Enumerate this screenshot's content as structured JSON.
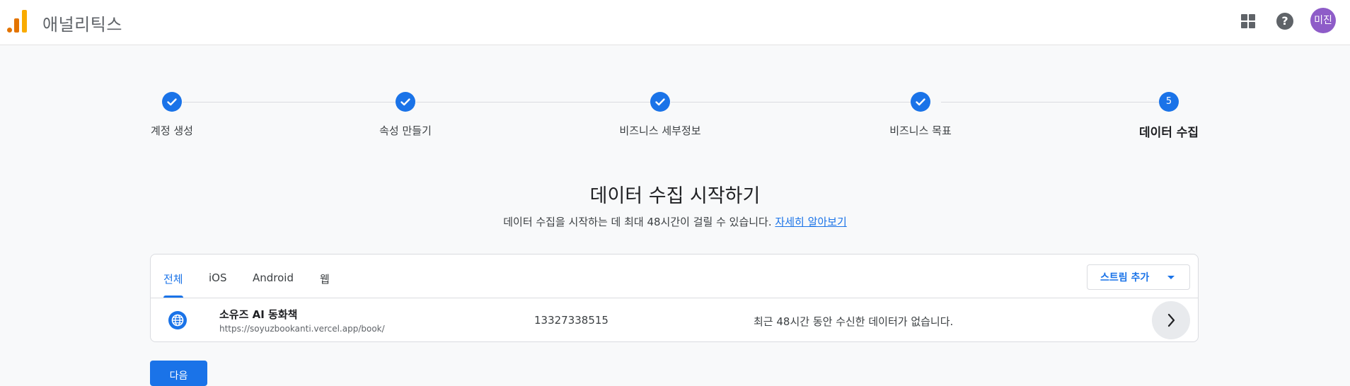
{
  "header": {
    "app_title": "애널리틱스",
    "avatar_text": "미진",
    "icons": [
      "analytics-logo-icon",
      "apps-grid-icon",
      "help-icon"
    ],
    "help_glyph": "?"
  },
  "stepper": {
    "steps": [
      {
        "label": "계정 생성",
        "state": "done"
      },
      {
        "label": "속성 만들기",
        "state": "done"
      },
      {
        "label": "비즈니스 세부정보",
        "state": "done"
      },
      {
        "label": "비즈니스 목표",
        "state": "done"
      },
      {
        "label": "데이터 수집",
        "state": "active",
        "number": "5"
      }
    ]
  },
  "main": {
    "heading": "데이터 수집 시작하기",
    "subtext": "데이터 수집을 시작하는 데 최대 48시간이 걸릴 수 있습니다.",
    "learn_more": "자세히 알아보기"
  },
  "streams": {
    "tabs": [
      {
        "label": "전체",
        "active": true
      },
      {
        "label": "iOS",
        "active": false
      },
      {
        "label": "Android",
        "active": false
      },
      {
        "label": "웹",
        "active": false
      }
    ],
    "add_stream_label": "스트림 추가",
    "rows": [
      {
        "name": "소유즈 AI 동화책",
        "url": "https://soyuzbookanti.vercel.app/book/",
        "id": "13327338515",
        "status": "최근 48시간 동안 수신한 데이터가 없습니다."
      }
    ]
  },
  "footer": {
    "next_label": "다음"
  },
  "colors": {
    "accent": "#1a73e8",
    "avatar": "#8e5cc8",
    "logo_orange": "#e37400",
    "logo_yellow": "#f9ab00"
  }
}
